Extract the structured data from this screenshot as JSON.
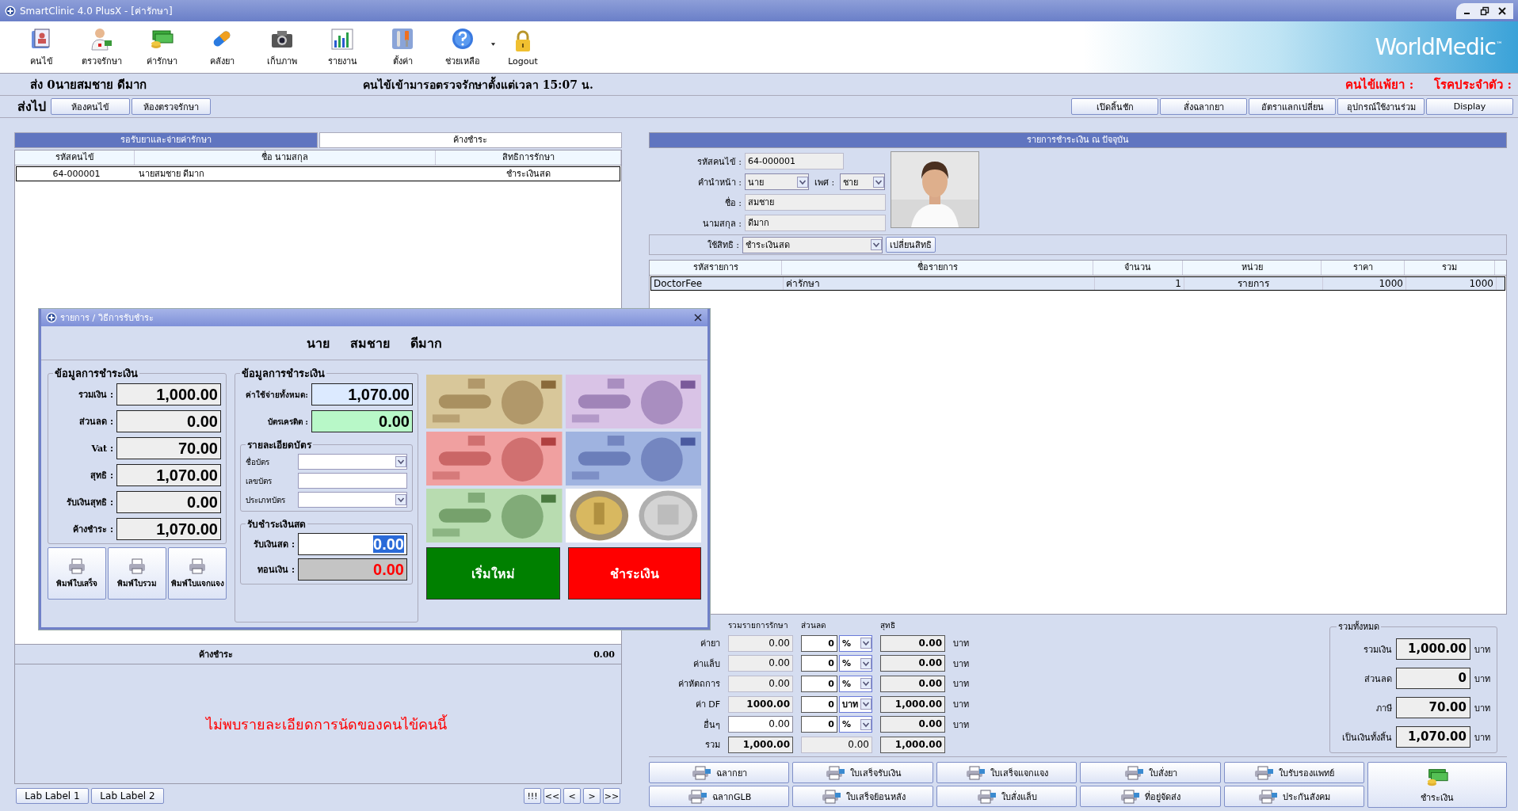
{
  "window": {
    "title": "SmartClinic 4.0 PlusX - [ค่ารักษา]"
  },
  "toolbar": [
    {
      "label": "คนไข้"
    },
    {
      "label": "ตรวจรักษา"
    },
    {
      "label": "ค่ารักษา"
    },
    {
      "label": "คลังยา"
    },
    {
      "label": "เก็บภาพ"
    },
    {
      "label": "รายงาน"
    },
    {
      "label": "ตั้งค่า"
    },
    {
      "label": "ช่วยเหลือ"
    },
    {
      "label": "Logout"
    }
  ],
  "brand": {
    "name": "WorldMedic",
    "mark": "™"
  },
  "header": {
    "patient": "ส่ง  0นายสมชาย ดีมาก",
    "waiting": "คนไข้เข้ามารอตรวจรักษาตั้งแต่เวลา 15:07 น.",
    "allergy": "คนไข้แพ้ยา :",
    "chronic": "โรคประจำตัว :"
  },
  "send_to": {
    "label": "ส่งไป",
    "buttons": [
      "ห้องคนไข้",
      "ห้องตรวจรักษา"
    ]
  },
  "actions": [
    "เปิดลิ้นชัก",
    "สั่งฉลากยา",
    "อัตราแลกเปลี่ยน",
    "อุปกรณ์ใช้งานร่วม",
    "Display"
  ],
  "queue": {
    "tabs": [
      {
        "label": "รอรับยาและจ่ายค่ารักษา",
        "selected": true
      },
      {
        "label": "ค้างชำระ",
        "selected": false
      }
    ],
    "columns": [
      "รหัสคนไข้",
      "ชื่อ นามสกุล",
      "สิทธิการรักษา"
    ],
    "rows": [
      {
        "code": "64-000001",
        "name": "นายสมชาย ดีมาก",
        "right": "ชำระเงินสด",
        "selected": true
      }
    ],
    "outstanding": {
      "label": "ค้างชำระ",
      "value": "0.00"
    },
    "message": "ไม่พบรายละเอียดการนัดของคนไข้คนนี้",
    "lab_tabs": [
      "Lab Label 1",
      "Lab Label 2"
    ],
    "nav": [
      "!!!",
      "<<",
      "<",
      ">",
      ">>"
    ]
  },
  "dialog": {
    "title": "รายการ / วิธีการรับชำระ",
    "name_parts": [
      "นาย",
      "สมชาย",
      "ดีมาก"
    ],
    "summary": {
      "title": "ข้อมูลการชำระเงิน",
      "fields": [
        {
          "label": "รวมเงิน :",
          "value": "1,000.00"
        },
        {
          "label": "ส่วนลด :",
          "value": "0.00"
        },
        {
          "label": "Vat :",
          "value": "70.00"
        },
        {
          "label": "สุทธิ :",
          "value": "1,070.00"
        },
        {
          "label": "รับเงินสุทธิ :",
          "value": "0.00"
        },
        {
          "label": "ค้างชำระ :",
          "value": "1,070.00"
        }
      ]
    },
    "print_buttons": [
      "พิมพ์ใบเสร็จ",
      "พิมพ์ใบรวม",
      "พิมพ์ใบแจกแจง"
    ],
    "payment": {
      "title": "ข้อมูลการชำระเงิน",
      "total": {
        "label": "ค่าใช้จ่ายทั้งหมด:",
        "value": "1,070.00"
      },
      "credit": {
        "label": "บัตรเครดิต :",
        "value": "0.00"
      },
      "card": {
        "title": "รายละเอียดบัตร",
        "fields": [
          {
            "label": "ชื่อบัตร",
            "kind": "select"
          },
          {
            "label": "เลขบัตร",
            "kind": "text"
          },
          {
            "label": "ประเภทบัตร",
            "kind": "select"
          }
        ]
      },
      "cash": {
        "title": "รับชำระเงินสด",
        "received": {
          "label": "รับเงินสด :",
          "value": "0.00"
        },
        "change": {
          "label": "ทอนเงิน :",
          "value": "0.00"
        }
      }
    },
    "actions": [
      {
        "label": "เริ่มใหม่",
        "color": "#008000"
      },
      {
        "label": "ชำระเงิน",
        "color": "#ff0000"
      }
    ]
  },
  "billing": {
    "title": "รายการชำระเงิน ณ ปัจจุบัน",
    "patient": {
      "code_label": "รหัสคนไข้ :",
      "code": "64-000001",
      "prefix_label": "คำนำหน้า :",
      "prefix": "นาย",
      "sex_label": "เพศ :",
      "sex": "ชาย",
      "first_label": "ชื่อ :",
      "first": "สมชาย",
      "last_label": "นามสกุล :",
      "last": "ดีมาก",
      "right_label": "ใช้สิทธิ :",
      "right": "ชำระเงินสด",
      "change_right": "เปลี่ยนสิทธิ"
    },
    "columns": [
      "รหัสรายการ",
      "ชื่อรายการ",
      "จำนวน",
      "หน่วย",
      "ราคา",
      "รวม"
    ],
    "rows": [
      {
        "cells": [
          "DoctorFee",
          "ค่ารักษา",
          "1",
          "รายการ",
          "1000",
          "1000"
        ],
        "selected": true
      }
    ]
  },
  "charges": {
    "headers": [
      "รวมรายการรักษา",
      "ส่วนลด",
      "สุทธิ"
    ],
    "rows": [
      {
        "label": "ค่ายา",
        "amount": "0.00",
        "discount": "0",
        "unit": "%",
        "net": "0.00",
        "suffix": "บาท",
        "editable": false
      },
      {
        "label": "ค่าแล็บ",
        "amount": "0.00",
        "discount": "0",
        "unit": "%",
        "net": "0.00",
        "suffix": "บาท",
        "editable": false
      },
      {
        "label": "ค่าหัตถการ",
        "amount": "0.00",
        "discount": "0",
        "unit": "%",
        "net": "0.00",
        "suffix": "บาท",
        "editable": false
      },
      {
        "label": "ค่า DF",
        "amount": "1000.00",
        "discount": "0",
        "unit": "บาท",
        "net": "1,000.00",
        "suffix": "บาท",
        "editable": false
      },
      {
        "label": "อื่นๆ",
        "amount": "0.00",
        "discount": "0",
        "unit": "%",
        "net": "0.00",
        "suffix": "บาท",
        "editable": true
      }
    ],
    "total": {
      "label": "รวม",
      "amount": "1,000.00",
      "discount": "0.00",
      "net": "1,000.00"
    }
  },
  "grand_total": {
    "title": "รวมทั้งหมด",
    "rows": [
      {
        "label": "รวมเงิน",
        "value": "1,000.00",
        "unit": "บาท"
      },
      {
        "label": "ส่วนลด",
        "value": "0",
        "unit": "บาท"
      },
      {
        "label": "ภาษี",
        "value": "70.00",
        "unit": "บาท"
      },
      {
        "label": "เป็นเงินทั้งสิ้น",
        "value": "1,070.00",
        "unit": "บาท"
      }
    ]
  },
  "print_buttons": [
    "ฉลากยา",
    "ใบเสร็จรับเงิน",
    "ใบเสร็จแจกแจง",
    "ใบสั่งยา",
    "ใบรับรองแพทย์",
    "ฉลากGLB",
    "ใบเสร็จย้อนหลัง",
    "ใบสั่งแล็บ",
    "ที่อยู่จัดส่ง",
    "ประกันสังคม"
  ],
  "pay_button": "ชำระเงิน"
}
